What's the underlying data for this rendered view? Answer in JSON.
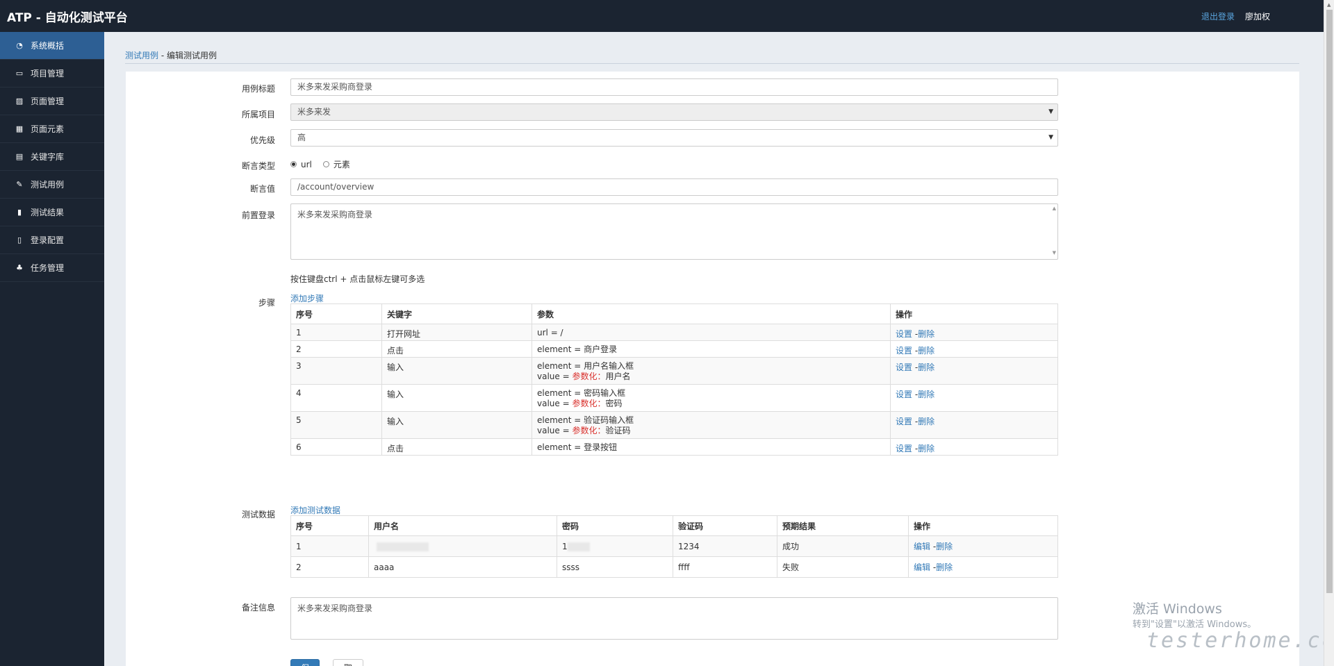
{
  "app": {
    "title": "ATP - 自动化测试平台",
    "logout": "退出登录",
    "user": "廖加权"
  },
  "sidebar": {
    "items": [
      {
        "label": "系统概括",
        "icon": "dashboard-icon",
        "glyph": "◔"
      },
      {
        "label": "项目管理",
        "icon": "monitor-icon",
        "glyph": "▭"
      },
      {
        "label": "页面管理",
        "icon": "picture-icon",
        "glyph": "▨"
      },
      {
        "label": "页面元素",
        "icon": "grid-icon",
        "glyph": "▦"
      },
      {
        "label": "关键字库",
        "icon": "table-icon",
        "glyph": "▤"
      },
      {
        "label": "测试用例",
        "icon": "edit-icon",
        "glyph": "✎"
      },
      {
        "label": "测试结果",
        "icon": "file-icon",
        "glyph": "▮"
      },
      {
        "label": "登录配置",
        "icon": "book-icon",
        "glyph": "▯"
      },
      {
        "label": "任务管理",
        "icon": "sitemap-icon",
        "glyph": "♣"
      }
    ]
  },
  "breadcrumb": {
    "link": "测试用例",
    "sep": " - ",
    "current": "编辑测试用例"
  },
  "form": {
    "title_label": "用例标题",
    "title_value": "米多来发采购商登录",
    "project_label": "所属项目",
    "project_value": "米多来发",
    "priority_label": "优先级",
    "priority_value": "高",
    "assert_type_label": "断言类型",
    "assert_type_options": [
      "url",
      "元素"
    ],
    "assert_value_label": "断言值",
    "assert_value": "/account/overview",
    "pre_login_label": "前置登录",
    "pre_login_value": "米多来发采购商登录",
    "hint": "按住键盘ctrl + 点击鼠标左键可多选",
    "steps_label": "步骤",
    "add_step": "添加步骤",
    "testdata_label": "测试数据",
    "add_testdata": "添加测试数据",
    "remark_label": "备注信息",
    "remark_value": "米多来发采购商登录",
    "save": "保存",
    "cancel": "取消"
  },
  "steps": {
    "headers": [
      "序号",
      "关键字",
      "参数",
      "操作"
    ],
    "param_prefix": "参数化：",
    "op_set": "设置",
    "op_sep": " -",
    "op_del": "删除",
    "rows": [
      {
        "no": "1",
        "keyword": "打开网址",
        "line1": "url = /",
        "line2_pre": "",
        "line2_param": "",
        "line2_val": ""
      },
      {
        "no": "2",
        "keyword": "点击",
        "line1": "element = 商户登录",
        "line2_pre": "",
        "line2_param": "",
        "line2_val": ""
      },
      {
        "no": "3",
        "keyword": "输入",
        "line1": "element = 用户名输入框",
        "line2_pre": "value = ",
        "line2_param": "参数化：",
        "line2_val": "用户名"
      },
      {
        "no": "4",
        "keyword": "输入",
        "line1": "element = 密码输入框",
        "line2_pre": "value = ",
        "line2_param": "参数化：",
        "line2_val": "密码"
      },
      {
        "no": "5",
        "keyword": "输入",
        "line1": "element = 验证码输入框",
        "line2_pre": "value = ",
        "line2_param": "参数化：",
        "line2_val": "验证码"
      },
      {
        "no": "6",
        "keyword": "点击",
        "line1": "element = 登录按钮",
        "line2_pre": "",
        "line2_param": "",
        "line2_val": ""
      }
    ]
  },
  "testdata": {
    "headers": [
      "序号",
      "用户名",
      "密码",
      "验证码",
      "预期结果",
      "操作"
    ],
    "op_edit": "编辑",
    "op_sep": " -",
    "op_del": "删除",
    "rows": [
      {
        "no": "1",
        "username": "",
        "password": "1",
        "code": "1234",
        "expected": "成功",
        "blurred": true
      },
      {
        "no": "2",
        "username": "aaaa",
        "password": "ssss",
        "code": "ffff",
        "expected": "失败",
        "blurred": false
      }
    ]
  },
  "watermark": {
    "line1": "激活 Windows",
    "line2": "转到\"设置\"以激活 Windows。",
    "line3": "testerhome.com"
  }
}
